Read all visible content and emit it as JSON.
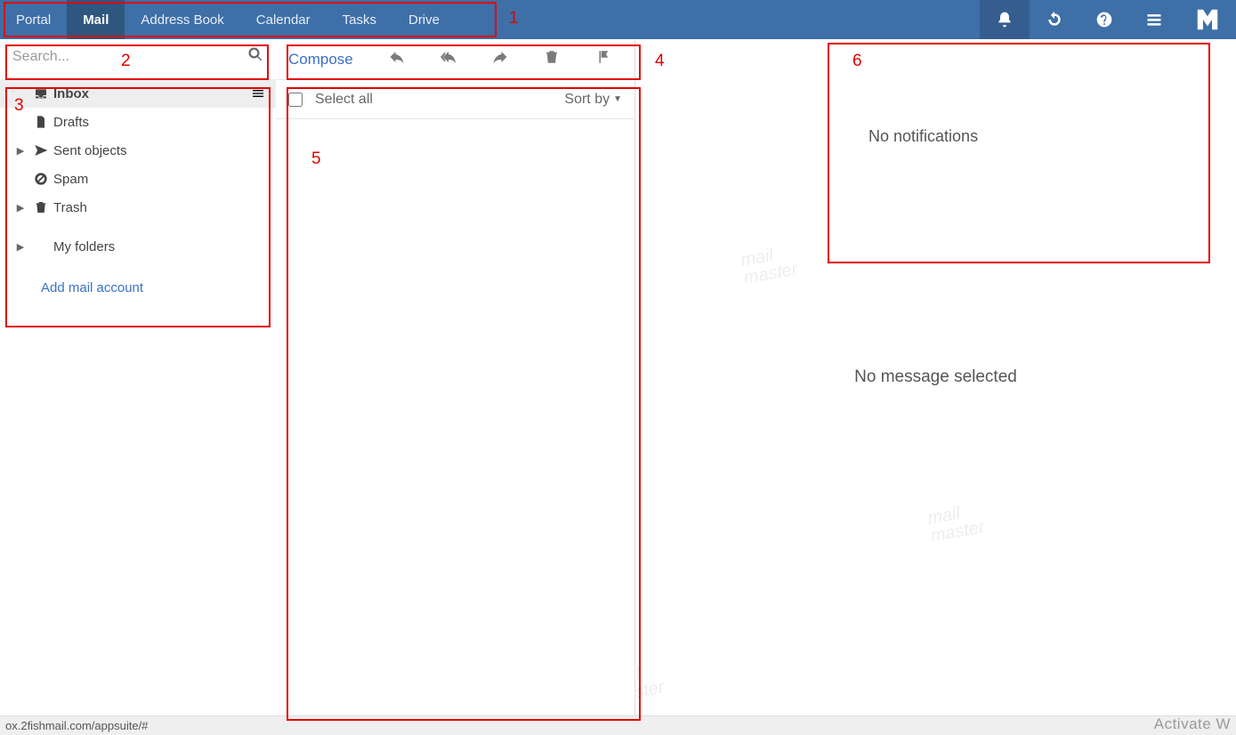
{
  "topnav": {
    "apps": [
      {
        "label": "Portal",
        "active": false
      },
      {
        "label": "Mail",
        "active": true
      },
      {
        "label": "Address Book",
        "active": false
      },
      {
        "label": "Calendar",
        "active": false
      },
      {
        "label": "Tasks",
        "active": false
      },
      {
        "label": "Drive",
        "active": false
      }
    ],
    "icons": [
      "bell",
      "refresh",
      "help",
      "menu"
    ],
    "brand": "mailmaster"
  },
  "search": {
    "placeholder": "Search..."
  },
  "folders": {
    "items": [
      {
        "name": "Inbox",
        "icon": "inbox",
        "arrow": false,
        "selected": true,
        "menu": true
      },
      {
        "name": "Drafts",
        "icon": "file",
        "arrow": false
      },
      {
        "name": "Sent objects",
        "icon": "send",
        "arrow": true
      },
      {
        "name": "Spam",
        "icon": "ban",
        "arrow": false
      },
      {
        "name": "Trash",
        "icon": "trash",
        "arrow": true
      }
    ],
    "myfolders_label": "My folders",
    "add_account_label": "Add mail account"
  },
  "toolbar": {
    "compose_label": "Compose",
    "actions": [
      "reply",
      "reply-all",
      "forward",
      "delete",
      "flag"
    ]
  },
  "listheader": {
    "select_all_label": "Select all",
    "sort_label": "Sort by"
  },
  "reading": {
    "empty_label": "No message selected"
  },
  "notifications": {
    "empty_label": "No notifications"
  },
  "status": {
    "url": "ox.2fishmail.com/appsuite/#",
    "quotes": "“",
    "activate": "Activate W"
  },
  "watermark": {
    "line1": "mail",
    "line2": "master"
  },
  "annotations": {
    "n1": "1",
    "n2": "2",
    "n3": "3",
    "n4": "4",
    "n5": "5",
    "n6": "6"
  }
}
